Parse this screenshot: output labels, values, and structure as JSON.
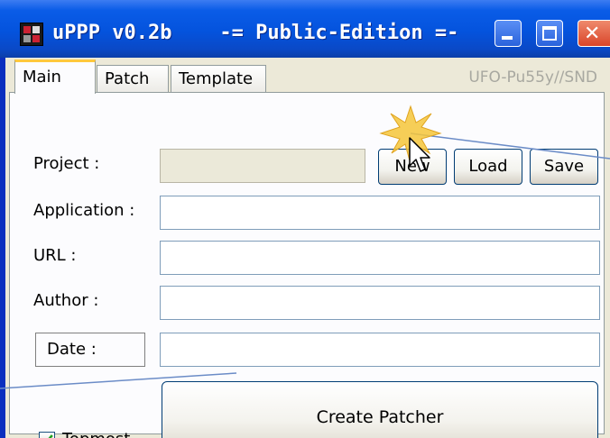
{
  "window": {
    "title": "uPPP v0.2b    -= Public-Edition =-",
    "icon": "app-icon"
  },
  "tabs": [
    {
      "label": "Main",
      "active": true
    },
    {
      "label": "Patch",
      "active": false
    },
    {
      "label": "Template",
      "active": false
    }
  ],
  "signature": "UFO-Pu55y//SND",
  "form": {
    "project_label": "Project :",
    "project_value": "",
    "application_label": "Application :",
    "application_value": "",
    "url_label": "URL :",
    "url_value": "",
    "author_label": "Author :",
    "author_value": "",
    "date_label": "Date :",
    "date_value": ""
  },
  "buttons": {
    "new": "New",
    "load": "Load",
    "save": "Save",
    "create_patcher": "Create Patcher"
  },
  "topmost": {
    "label": "Topmost",
    "checked": true
  },
  "colors": {
    "titlebar": "#0453dd",
    "active_tab_accent": "#ffc83c",
    "close_button": "#d9452a"
  }
}
